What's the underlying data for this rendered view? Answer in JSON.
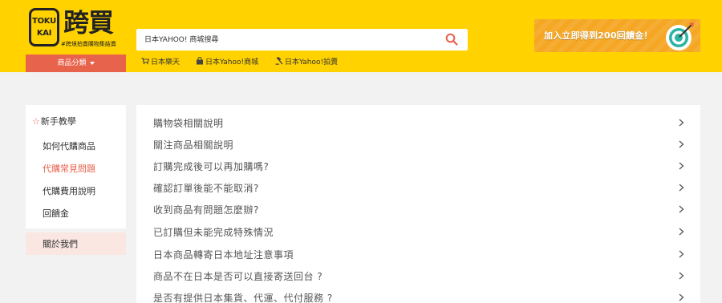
{
  "header": {
    "logo": {
      "badge_top": "TOKU",
      "badge_bottom": "KAI",
      "brand": "跨買",
      "tagline": "#跨境拍賣購物集結賣"
    },
    "search": {
      "placeholder": "日本YAHOO! 商城搜尋",
      "icon": "search-icon"
    },
    "promo": {
      "text": "加入立即得到200回饋金！",
      "icon": "target-icon"
    },
    "category_button": "商品分類",
    "nav_links": [
      {
        "label": "日本樂天",
        "icon": "cart-icon"
      },
      {
        "label": "日本Yahoo!商城",
        "icon": "shop-icon"
      },
      {
        "label": "日本Yahoo!拍賣",
        "icon": "gavel-icon"
      }
    ]
  },
  "sidebar": {
    "heading": "新手教學",
    "items": [
      {
        "label": "如何代購商品",
        "active": false
      },
      {
        "label": "代購常見問題",
        "active": true
      },
      {
        "label": "代購費用說明",
        "active": false
      },
      {
        "label": "回饋金",
        "active": false
      }
    ],
    "about": "關於我們"
  },
  "faq": [
    "購物袋相關說明",
    "關注商品相關說明",
    "訂購完成後可以再加購嗎?",
    "確認訂單後能不能取消?",
    "收到商品有問題怎麼辦?",
    "已訂購但未能完成特殊情況",
    "日本商品轉寄日本地址注意事項",
    "商品不在日本是否可以直接寄送回台 ?",
    "是否有提供日本集貨、代運、代付服務 ?"
  ],
  "colors": {
    "header_bg": "#ffd200",
    "accent": "#e8634c",
    "promo_bg": "#f5a623",
    "page_bg": "#f2f2f2"
  }
}
